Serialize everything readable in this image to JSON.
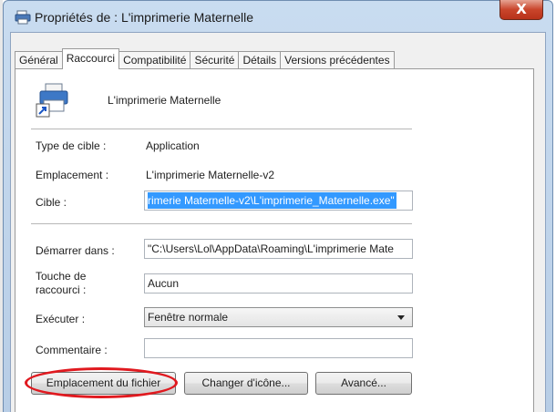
{
  "window": {
    "title": "Propriétés de : L'imprimerie Maternelle",
    "close_symbol": "X",
    "icon": "printer-icon"
  },
  "tabs": [
    {
      "label": "Général",
      "active": false
    },
    {
      "label": "Raccourci",
      "active": true
    },
    {
      "label": "Compatibilité",
      "active": false
    },
    {
      "label": "Sécurité",
      "active": false
    },
    {
      "label": "Détails",
      "active": false
    },
    {
      "label": "Versions précédentes",
      "active": false
    }
  ],
  "shortcut": {
    "name": "L'imprimerie Maternelle",
    "icon": "printer-shortcut-icon",
    "target_type_label": "Type de cible :",
    "target_type_value": "Application",
    "location_label": "Emplacement :",
    "location_value": "L'imprimerie Maternelle-v2",
    "target_label": "Cible :",
    "target_value": "rimerie Maternelle-v2\\L'imprimerie_Maternelle.exe\"",
    "start_in_label": "Démarrer dans :",
    "start_in_value": "\"C:\\Users\\Lol\\AppData\\Roaming\\L'imprimerie Mate",
    "hotkey_label_line1": "Touche de",
    "hotkey_label_line2": "raccourci :",
    "hotkey_value": "Aucun",
    "run_label": "Exécuter :",
    "run_value": "Fenêtre normale",
    "comment_label": "Commentaire :",
    "comment_value": ""
  },
  "buttons": {
    "open_location": "Emplacement du fichier",
    "change_icon": "Changer d'icône...",
    "advanced": "Avancé..."
  },
  "colors": {
    "selection": "#3399ff",
    "highlight_circle": "#e0191f",
    "close_button": "#c9452b"
  }
}
